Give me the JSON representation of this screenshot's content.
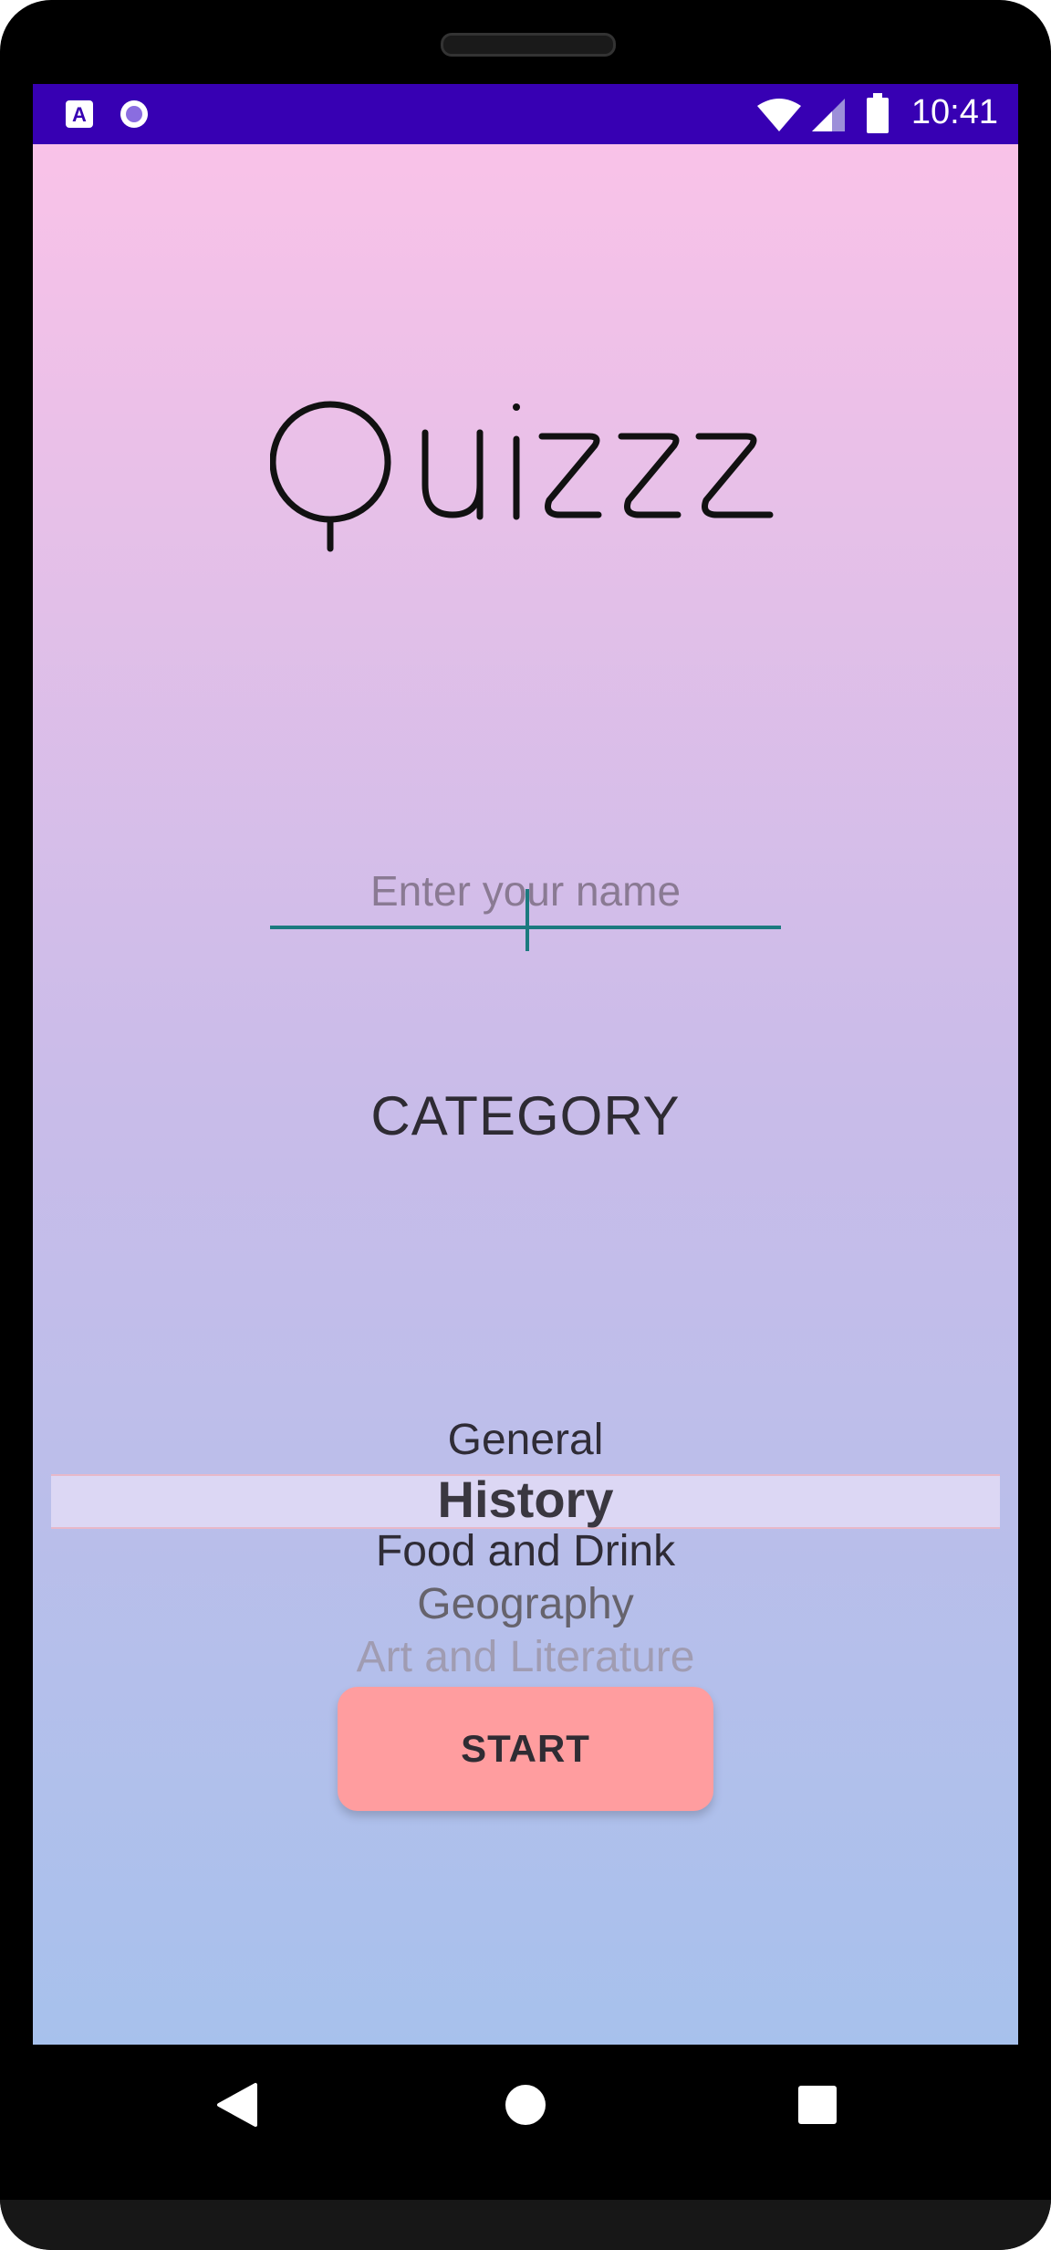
{
  "status_bar": {
    "time": "10:41",
    "left_icons": [
      "accessibility-a-icon",
      "recording-dot-icon"
    ],
    "right_icons": [
      "wifi-icon",
      "cell-signal-icon",
      "battery-icon"
    ],
    "background": "#3700b3"
  },
  "app": {
    "logo_text": "Quizzz",
    "name_input": {
      "placeholder": "Enter your name",
      "value": ""
    },
    "category_heading": "CATEGORY",
    "category_picker": {
      "items": [
        "General",
        "History",
        "Food and Drink",
        "Geography",
        "Art and Literature"
      ],
      "selected": "History"
    },
    "start_button_label": "START",
    "colors": {
      "gradient_top": "#f9c2e8",
      "gradient_bottom": "#a7c1ec",
      "accent_underline": "#1b7a7f",
      "start_button": "#ff9d9f"
    }
  },
  "nav_bar": {
    "buttons": [
      "back-icon",
      "home-icon",
      "recents-icon"
    ]
  }
}
